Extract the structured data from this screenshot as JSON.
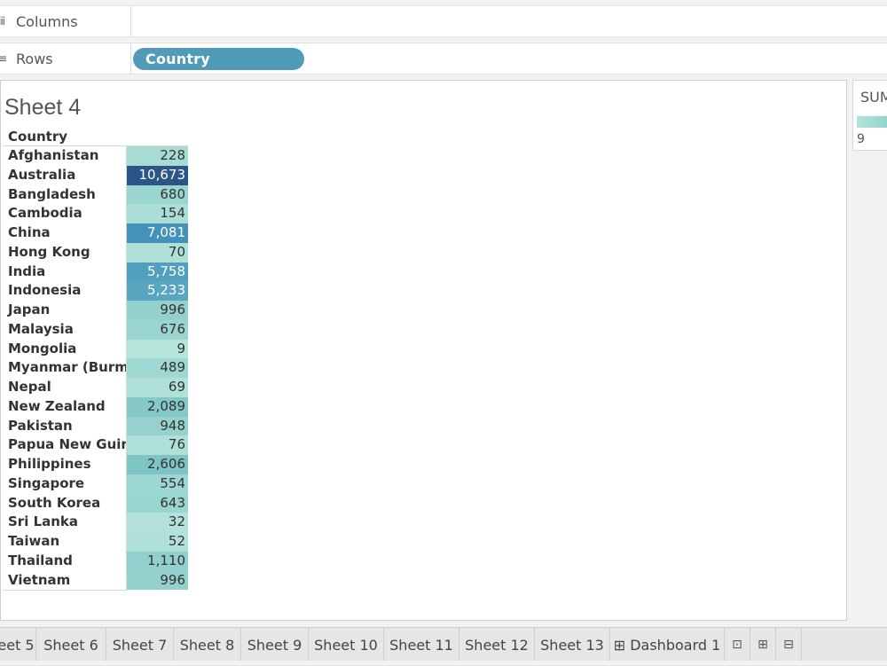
{
  "shelves": {
    "columns_label": "Columns",
    "columns_icon": "iii",
    "rows_label": "Rows",
    "rows_icon": "≡",
    "rows_pill": "Country"
  },
  "view": {
    "title": "Sheet 4",
    "column_header": "Country",
    "rows": [
      {
        "country": "Afghanistan",
        "value": "228"
      },
      {
        "country": "Australia",
        "value": "10,673"
      },
      {
        "country": "Bangladesh",
        "value": "680"
      },
      {
        "country": "Cambodia",
        "value": "154"
      },
      {
        "country": "China",
        "value": "7,081"
      },
      {
        "country": "Hong Kong",
        "value": "70"
      },
      {
        "country": "India",
        "value": "5,758"
      },
      {
        "country": "Indonesia",
        "value": "5,233"
      },
      {
        "country": "Japan",
        "value": "996"
      },
      {
        "country": "Malaysia",
        "value": "676"
      },
      {
        "country": "Mongolia",
        "value": "9"
      },
      {
        "country": "Myanmar (Burma)",
        "value": "489"
      },
      {
        "country": "Nepal",
        "value": "69"
      },
      {
        "country": "New Zealand",
        "value": "2,089"
      },
      {
        "country": "Pakistan",
        "value": "948"
      },
      {
        "country": "Papua New Guin..",
        "value": "76"
      },
      {
        "country": "Philippines",
        "value": "2,606"
      },
      {
        "country": "Singapore",
        "value": "554"
      },
      {
        "country": "South Korea",
        "value": "643"
      },
      {
        "country": "Sri Lanka",
        "value": "32"
      },
      {
        "country": "Taiwan",
        "value": "52"
      },
      {
        "country": "Thailand",
        "value": "1,110"
      },
      {
        "country": "Vietnam",
        "value": "996"
      }
    ],
    "color_min": "#b8e6dc",
    "color_max": "#2b5586"
  },
  "legend": {
    "title": "SUM",
    "min_label": "9"
  },
  "tabs": [
    {
      "label": "eet 5"
    },
    {
      "label": "Sheet 6"
    },
    {
      "label": "Sheet 7"
    },
    {
      "label": "Sheet 8"
    },
    {
      "label": "Sheet 9"
    },
    {
      "label": "Sheet 10"
    },
    {
      "label": "Sheet 11"
    },
    {
      "label": "Sheet 12"
    },
    {
      "label": "Sheet 13"
    },
    {
      "label": "⊞ Dashboard 1"
    }
  ],
  "tab_icons": [
    "new-worksheet-icon",
    "new-dashboard-icon",
    "new-story-icon"
  ]
}
